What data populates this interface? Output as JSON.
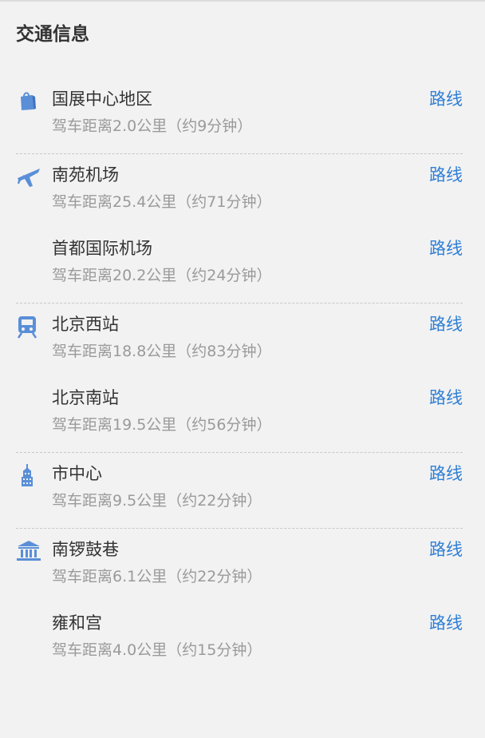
{
  "title": "交通信息",
  "accent_color": "#2f7fd6",
  "groups": [
    {
      "icon": "shopping-bag-icon",
      "items": [
        {
          "name": "国展中心地区",
          "distance": "驾车距离2.0公里（约9分钟）",
          "route_label": "路线"
        }
      ]
    },
    {
      "icon": "airplane-icon",
      "items": [
        {
          "name": "南苑机场",
          "distance": "驾车距离25.4公里（约71分钟）",
          "route_label": "路线"
        },
        {
          "name": "首都国际机场",
          "distance": "驾车距离20.2公里（约24分钟）",
          "route_label": "路线"
        }
      ]
    },
    {
      "icon": "train-icon",
      "items": [
        {
          "name": "北京西站",
          "distance": "驾车距离18.8公里（约83分钟）",
          "route_label": "路线"
        },
        {
          "name": "北京南站",
          "distance": "驾车距离19.5公里（约56分钟）",
          "route_label": "路线"
        }
      ]
    },
    {
      "icon": "city-building-icon",
      "items": [
        {
          "name": "市中心",
          "distance": "驾车距离9.5公里（约22分钟）",
          "route_label": "路线"
        }
      ]
    },
    {
      "icon": "landmark-icon",
      "items": [
        {
          "name": "南锣鼓巷",
          "distance": "驾车距离6.1公里（约22分钟）",
          "route_label": "路线"
        },
        {
          "name": "雍和宫",
          "distance": "驾车距离4.0公里（约15分钟）",
          "route_label": "路线"
        }
      ]
    }
  ]
}
